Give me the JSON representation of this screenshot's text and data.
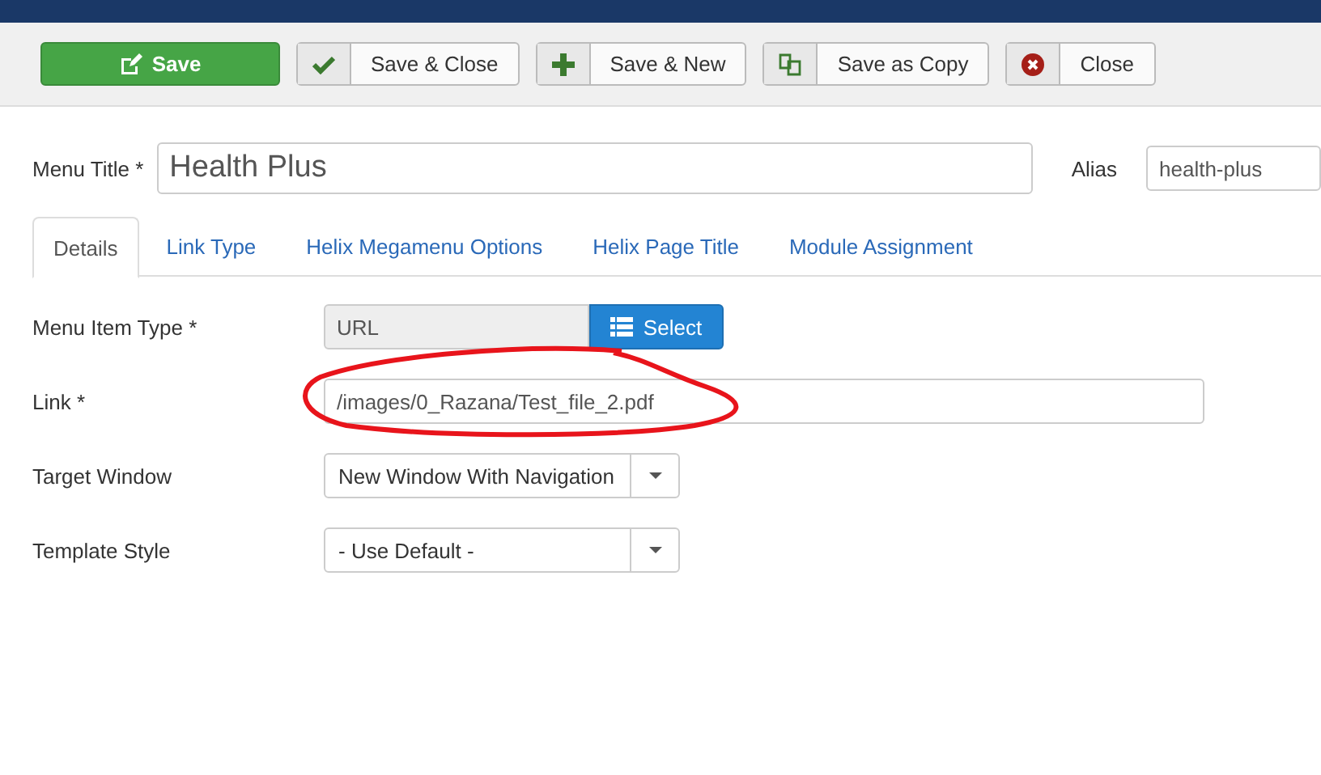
{
  "toolbar": {
    "buttons": [
      {
        "label": "Save",
        "kind": "primary"
      },
      {
        "label": "Save & Close",
        "kind": "check"
      },
      {
        "label": "Save & New",
        "kind": "plus"
      },
      {
        "label": "Save as Copy",
        "kind": "copy"
      },
      {
        "label": "Close",
        "kind": "cancel"
      }
    ]
  },
  "menu_title": {
    "label": "Menu Title *",
    "value": "Health Plus"
  },
  "alias": {
    "label": "Alias",
    "value": "health-plus"
  },
  "tabs": [
    {
      "label": "Details",
      "selected": true
    },
    {
      "label": "Link Type",
      "selected": false
    },
    {
      "label": "Helix Megamenu Options",
      "selected": false
    },
    {
      "label": "Helix Page Title",
      "selected": false
    },
    {
      "label": "Module Assignment",
      "selected": false
    }
  ],
  "fields": [
    {
      "label": "Menu Item Type *",
      "kind": "picker",
      "value": "URL",
      "button": "Select"
    },
    {
      "label": "Link *",
      "kind": "text",
      "value": "/images/0_Razana/Test_file_2.pdf",
      "circled": true
    },
    {
      "label": "Target Window",
      "kind": "select",
      "value": "New Window With Navigation"
    },
    {
      "label": "Template Style",
      "kind": "select",
      "value": "- Use Default -"
    }
  ]
}
